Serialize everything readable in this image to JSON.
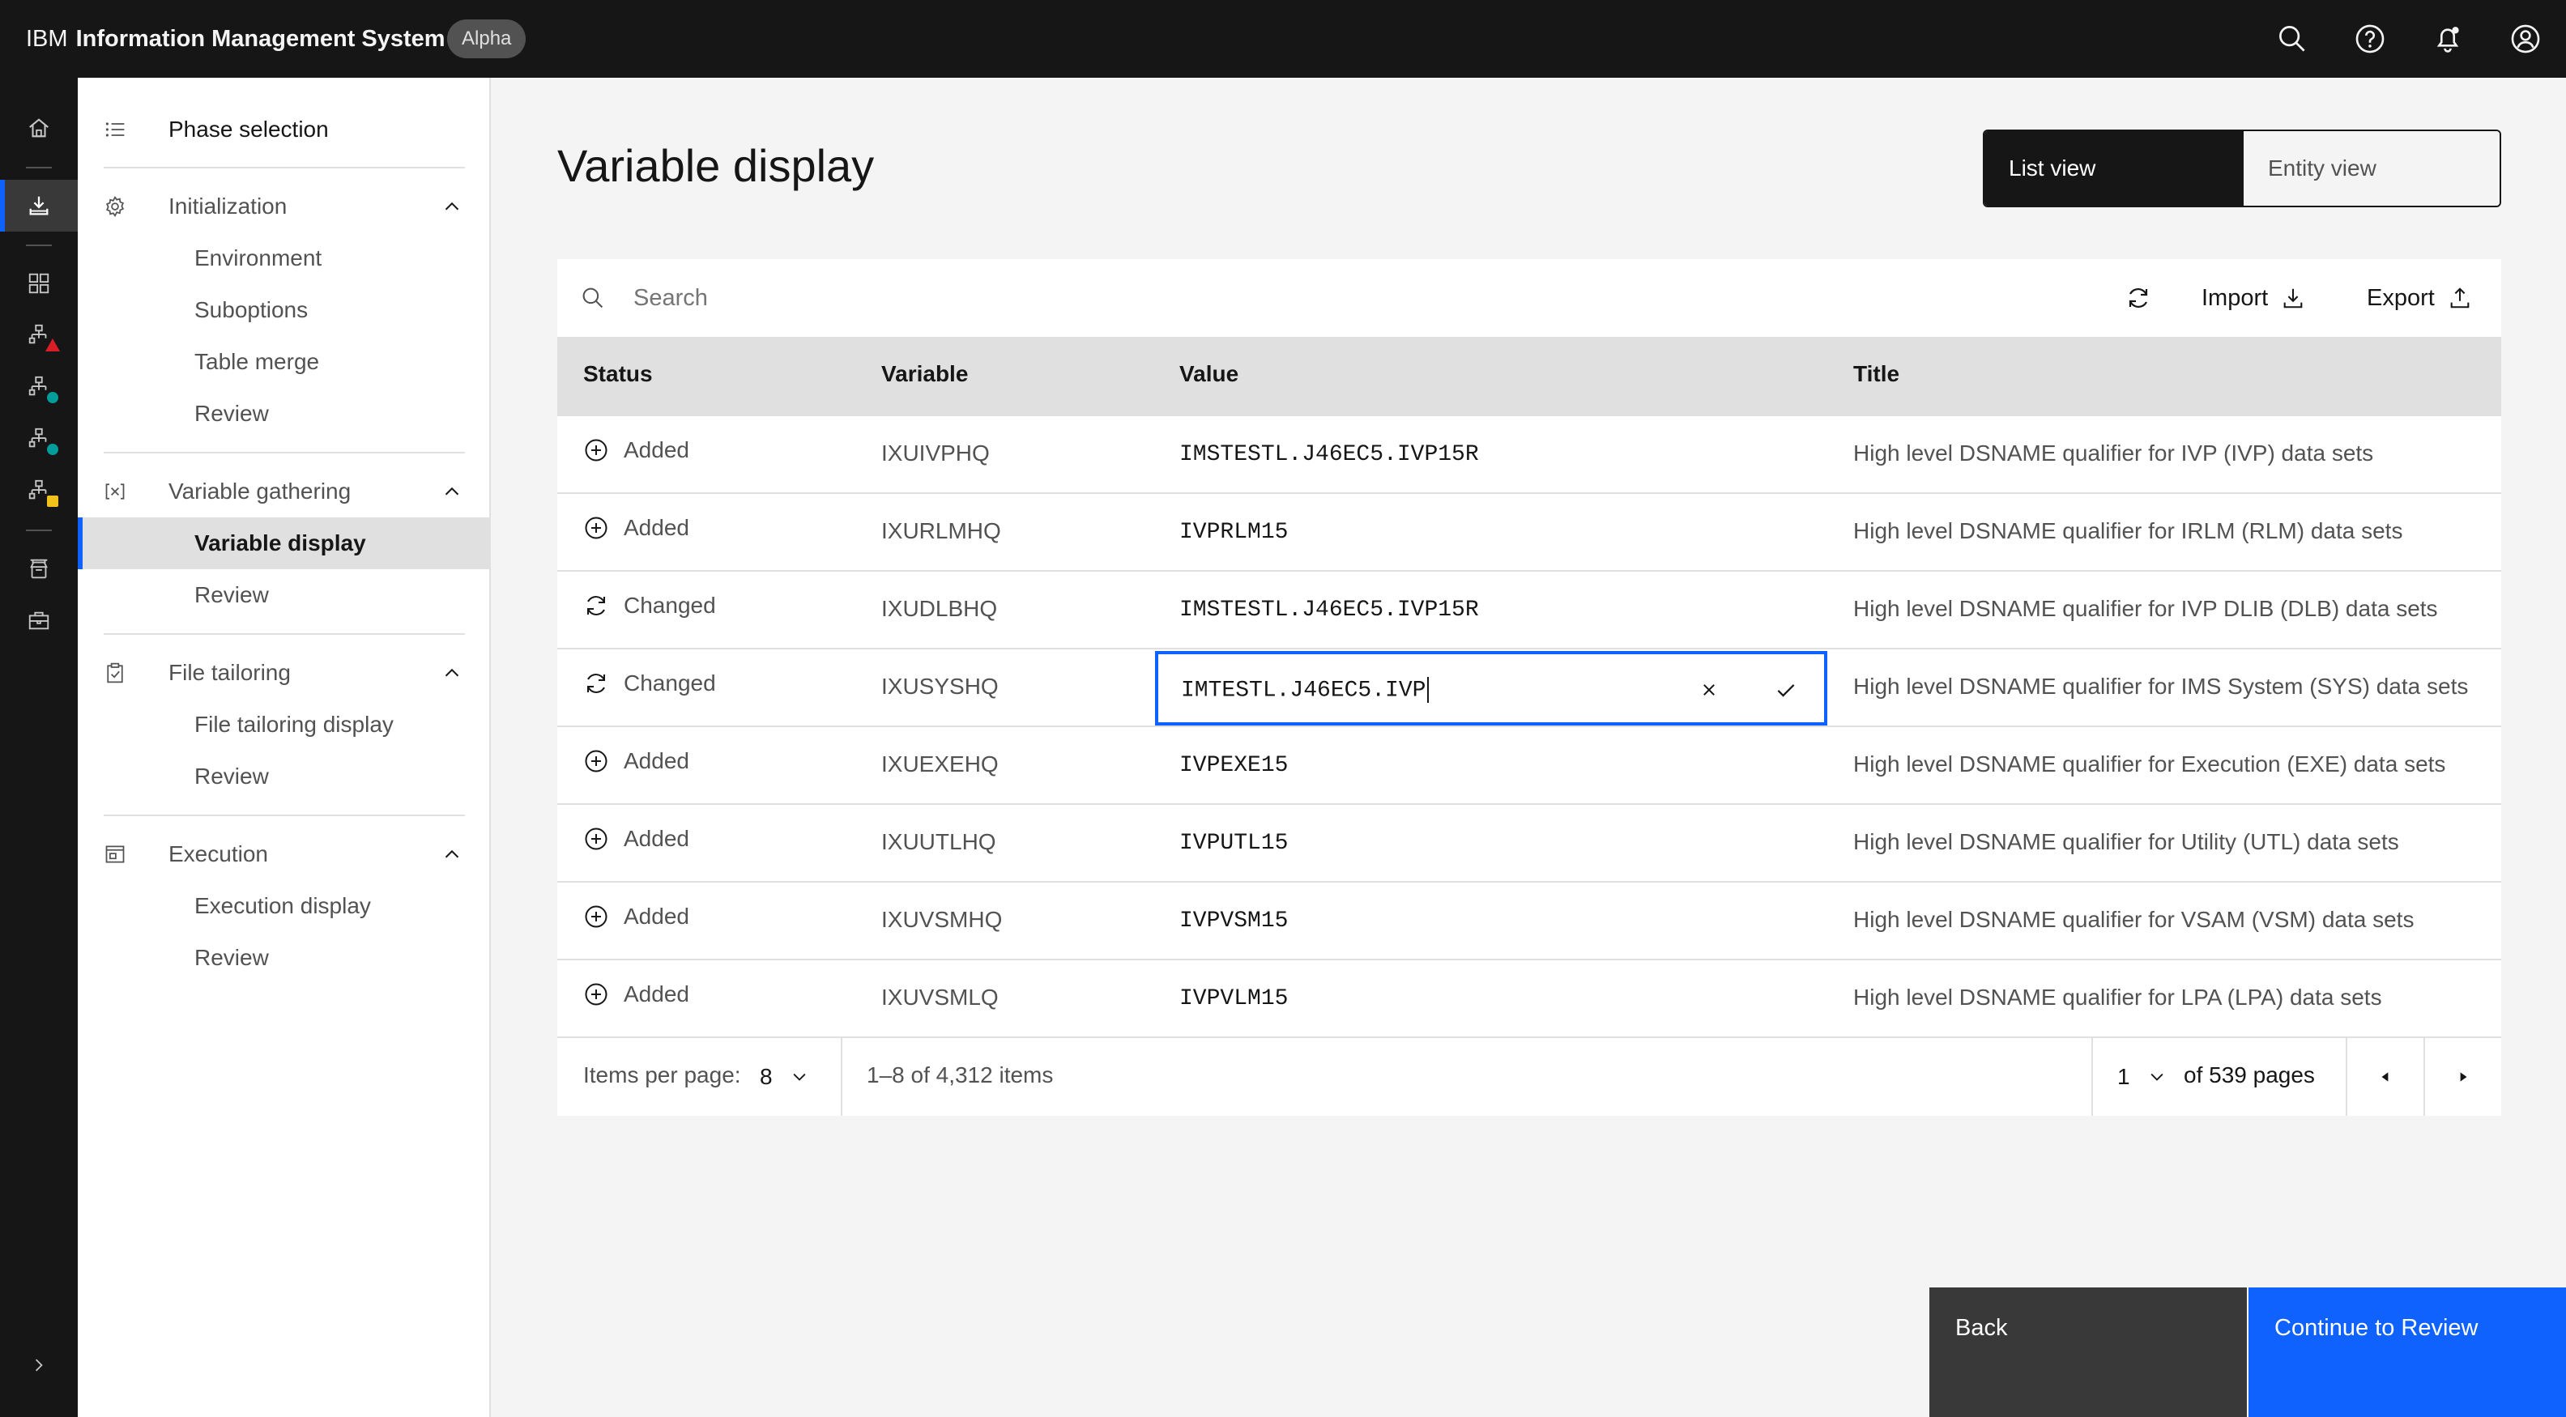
{
  "header": {
    "brand_prefix": "IBM",
    "brand_name": "Information Management System",
    "tag": "Alpha"
  },
  "sidenav": {
    "phase_selection": "Phase selection",
    "sections": [
      {
        "label": "Initialization",
        "items": [
          "Environment",
          "Suboptions",
          "Table merge",
          "Review"
        ]
      },
      {
        "label": "Variable gathering",
        "items": [
          "Variable display",
          "Review"
        ]
      },
      {
        "label": "File tailoring",
        "items": [
          "File tailoring display",
          "Review"
        ]
      },
      {
        "label": "Execution",
        "items": [
          "Execution display",
          "Review"
        ]
      }
    ],
    "active_item": "Variable display"
  },
  "page": {
    "title": "Variable display",
    "view_switcher": {
      "list": "List view",
      "entity": "Entity view",
      "selected": "List view"
    }
  },
  "toolbar": {
    "search_placeholder": "Search",
    "import_label": "Import",
    "export_label": "Export"
  },
  "table": {
    "columns": [
      "Status",
      "Variable",
      "Value",
      "Title"
    ],
    "rows": [
      {
        "status": "Added",
        "variable": "IXUIVPHQ",
        "value": "IMSTESTL.J46EC5.IVP15R",
        "title": "High level DSNAME qualifier for IVP (IVP) data sets"
      },
      {
        "status": "Added",
        "variable": "IXURLMHQ",
        "value": "IVPRLM15",
        "title": "High level DSNAME qualifier for IRLM (RLM) data sets"
      },
      {
        "status": "Changed",
        "variable": "IXUDLBHQ",
        "value": "IMSTESTL.J46EC5.IVP15R",
        "title": "High level DSNAME qualifier for IVP DLIB (DLB) data sets"
      },
      {
        "status": "Changed",
        "variable": "IXUSYSHQ",
        "value": "IMTESTL.J46EC5.IVP",
        "title": "High level DSNAME qualifier for IMS System (SYS) data sets"
      },
      {
        "status": "Added",
        "variable": "IXUEXEHQ",
        "value": "IVPEXE15",
        "title": "High level DSNAME qualifier for Execution (EXE) data sets"
      },
      {
        "status": "Added",
        "variable": "IXUUTLHQ",
        "value": "IVPUTL15",
        "title": "High level DSNAME qualifier for Utility (UTL) data sets"
      },
      {
        "status": "Added",
        "variable": "IXUVSMHQ",
        "value": "IVPVSM15",
        "title": "High level DSNAME qualifier for VSAM (VSM) data sets"
      },
      {
        "status": "Added",
        "variable": "IXUVSMLQ",
        "value": "IVPVLM15",
        "title": "High level DSNAME qualifier for LPA (LPA) data sets"
      }
    ],
    "editing_row": 3
  },
  "pagination": {
    "items_per_page_label": "Items per page:",
    "items_per_page": "8",
    "range_text": "1–8 of 4,312 items",
    "current_page": "1",
    "pages_text": "of 539 pages"
  },
  "footer": {
    "back_label": "Back",
    "continue_label": "Continue to Review"
  },
  "colors": {
    "accent": "#0f62fe",
    "header_bg": "#161616",
    "rail_red": "#da1e28",
    "rail_teal": "#009d9a",
    "rail_yellow": "#f1c21b"
  }
}
